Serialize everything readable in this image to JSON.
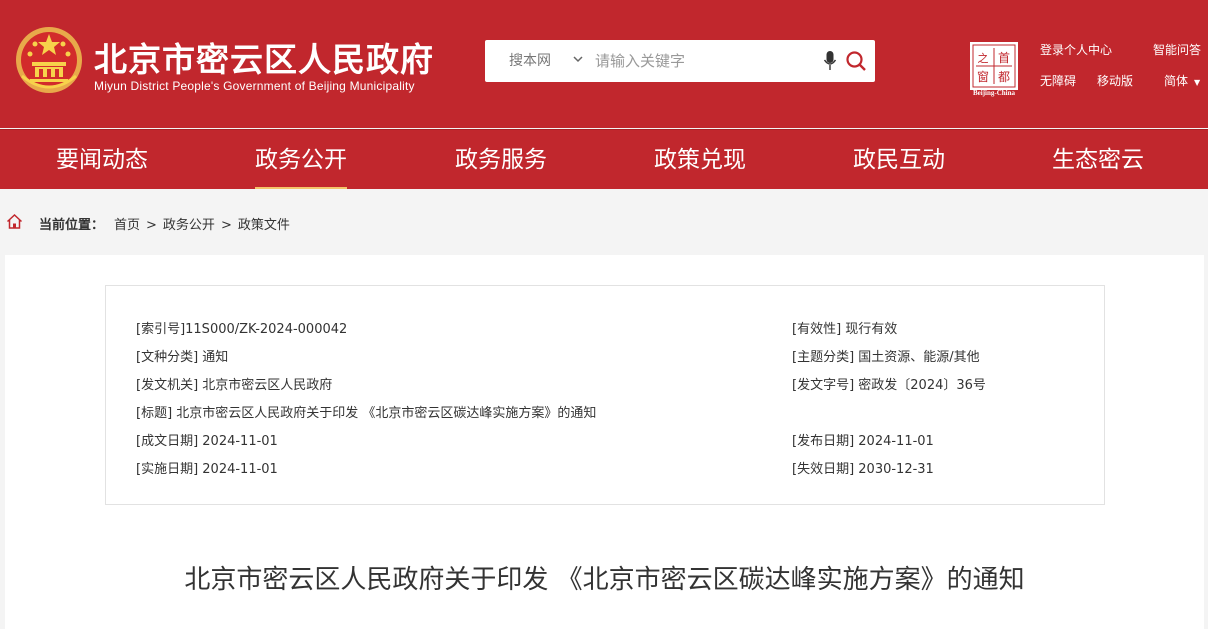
{
  "header": {
    "title_cn": "北京市密云区人民政府",
    "title_en": "Miyun District People's Government of Beijing Municipality",
    "search": {
      "scope": "搜本网",
      "placeholder": "请输入关键字"
    },
    "capital_logo_text": "Beijing-China",
    "links": {
      "login": "登录个人中心",
      "smart_qa": "智能问答",
      "accessibility": "无障碍",
      "mobile": "移动版",
      "language": "简体"
    },
    "colors": {
      "brand_red": "#c1272d",
      "nav_active_underline": "#f5c56a"
    }
  },
  "nav": {
    "items": [
      {
        "label": "要闻动态",
        "active": false
      },
      {
        "label": "政务公开",
        "active": true
      },
      {
        "label": "政务服务",
        "active": false
      },
      {
        "label": "政策兑现",
        "active": false
      },
      {
        "label": "政民互动",
        "active": false
      },
      {
        "label": "生态密云",
        "active": false
      }
    ]
  },
  "breadcrumb": {
    "label": "当前位置：",
    "items": [
      "首页",
      "政务公开",
      "政策文件"
    ],
    "separator": ">"
  },
  "meta": {
    "index_no": "[索引号]11S000/ZK-2024-000042",
    "validity": "[有效性] 现行有效",
    "doc_type": "[文种分类] 通知",
    "topic": "[主题分类] 国土资源、能源/其他",
    "issuer": "[发文机关] 北京市密云区人民政府",
    "doc_no": "[发文字号] 密政发〔2024〕36号",
    "title": "[标题] 北京市密云区人民政府关于印发 《北京市密云区碳达峰实施方案》的通知",
    "written_date": "[成文日期] 2024-11-01",
    "publish_date": "[发布日期] 2024-11-01",
    "effective_date": "[实施日期] 2024-11-01",
    "expiry_date": "[失效日期] 2030-12-31"
  },
  "document": {
    "title": "北京市密云区人民政府关于印发 《北京市密云区碳达峰实施方案》的通知"
  }
}
